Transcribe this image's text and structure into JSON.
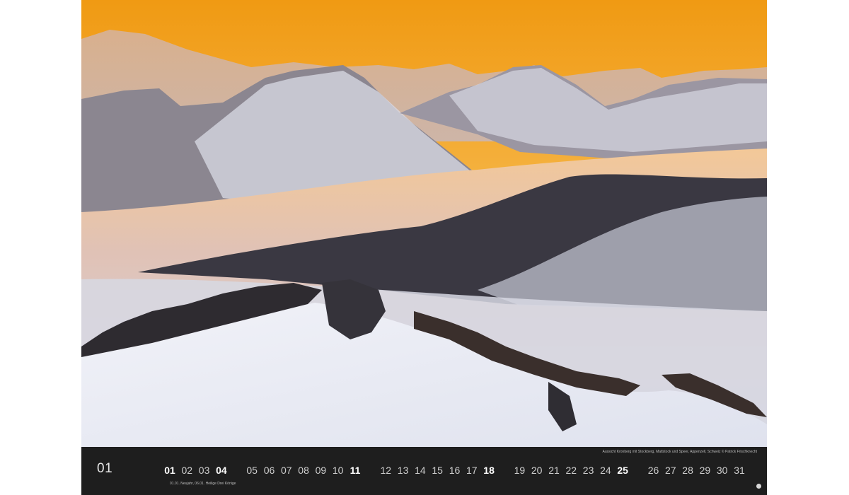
{
  "photo": {
    "subject": "mountain-landscape-photo",
    "colors": {
      "sky_top": "#f2a51a",
      "sky_bottom": "#f6c36b",
      "fog": "#d9d9e4",
      "snow": "#e9ecf4",
      "forest": "#2c2b34"
    }
  },
  "calendar": {
    "month_number": "01",
    "caption": "Aussicht Kronberg mit Stockberg, Mattstock und Speer, Appenzell, Schweiz © Patrick Frischknecht",
    "holiday_note": "01.01. Neujahr, 06.01. Heilige Drei Könige",
    "days": [
      {
        "label": "01",
        "bold": true
      },
      {
        "label": "02",
        "bold": false
      },
      {
        "label": "03",
        "bold": false
      },
      {
        "label": "04",
        "bold": true
      },
      {
        "label": "05",
        "bold": false
      },
      {
        "label": "06",
        "bold": false
      },
      {
        "label": "07",
        "bold": false
      },
      {
        "label": "08",
        "bold": false
      },
      {
        "label": "09",
        "bold": false
      },
      {
        "label": "10",
        "bold": false
      },
      {
        "label": "11",
        "bold": true
      },
      {
        "label": "12",
        "bold": false
      },
      {
        "label": "13",
        "bold": false
      },
      {
        "label": "14",
        "bold": false
      },
      {
        "label": "15",
        "bold": false
      },
      {
        "label": "16",
        "bold": false
      },
      {
        "label": "17",
        "bold": false
      },
      {
        "label": "18",
        "bold": true
      },
      {
        "label": "19",
        "bold": false
      },
      {
        "label": "20",
        "bold": false
      },
      {
        "label": "21",
        "bold": false
      },
      {
        "label": "22",
        "bold": false
      },
      {
        "label": "23",
        "bold": false
      },
      {
        "label": "24",
        "bold": false
      },
      {
        "label": "25",
        "bold": true
      },
      {
        "label": "26",
        "bold": false
      },
      {
        "label": "27",
        "bold": false
      },
      {
        "label": "28",
        "bold": false
      },
      {
        "label": "29",
        "bold": false
      },
      {
        "label": "30",
        "bold": false
      },
      {
        "label": "31",
        "bold": false
      }
    ]
  }
}
